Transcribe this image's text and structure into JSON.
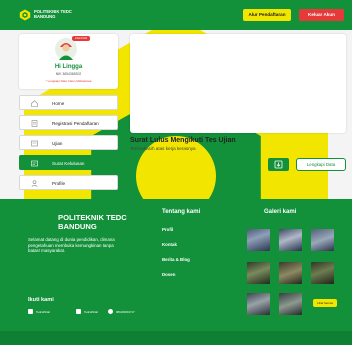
{
  "header": {
    "brand_line1": "POLITEKNIK TEDC",
    "brand_line2": "BANDUNG",
    "alur_button": "Alur Pendaftaran",
    "keluar_button": "Keluar Akun"
  },
  "profile": {
    "badge": "Lihat Profil",
    "greeting": "Hi Lingga",
    "nik": "NIK 3654365302",
    "complete_link": "* Lengkapi Data Calon Mahasiswa"
  },
  "sidebar": {
    "items": [
      {
        "label": "Home",
        "icon": "home-icon",
        "active": false
      },
      {
        "label": "Registrasi Pendaftaran",
        "icon": "form-icon",
        "active": false
      },
      {
        "label": "Ujian",
        "icon": "exam-icon",
        "active": false
      },
      {
        "label": "Surat Kelulusan",
        "icon": "certificate-icon",
        "active": true
      },
      {
        "label": "Profile",
        "icon": "user-icon",
        "active": false
      }
    ]
  },
  "main": {
    "title": "Surat Lulus Mengikuti Tes Ujian",
    "subtitle": "Terimakasih atas kerja kerasnya",
    "download_icon": "download-icon",
    "lengkapi_button": "Lengkapi Data"
  },
  "footer": {
    "brand_line1": "POLITEKNIK TEDC",
    "brand_line2": "BANDUNG",
    "description": "Selamat datang di dunia pendidikan, dimana pengetahuan membuka kemungkinan tanpa batas! masyarakat.",
    "tentang_title": "Tentang kami",
    "links": [
      "Profil",
      "Kontak",
      "Berita & Blog",
      "Dosen"
    ],
    "galeri_title": "Galeri kami",
    "ikuti_title": "Ikuti kami",
    "socials": [
      {
        "label": "Tedcofficial",
        "icon": "facebook-icon"
      },
      {
        "label": "Tedcofficial",
        "icon": "instagram-icon"
      },
      {
        "label": "081260001717",
        "icon": "whatsapp-icon"
      }
    ],
    "lihat_button": "Lihat Semua"
  },
  "colors": {
    "primary_green": "#13903a",
    "yellow": "#f2e600",
    "red": "#e63a3a"
  }
}
